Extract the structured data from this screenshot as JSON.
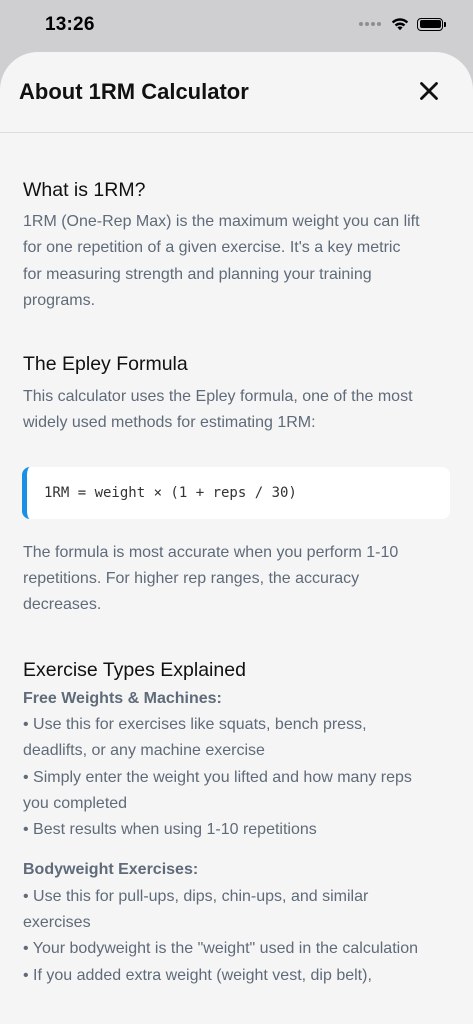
{
  "status_bar": {
    "time": "13:26"
  },
  "header": {
    "title": "About 1RM Calculator",
    "close_icon": "close-x-icon"
  },
  "sections": {
    "what": {
      "heading": "What is 1RM?",
      "lines": [
        "1RM (One-Rep Max) is the maximum weight you can lift",
        "for one repetition of a given exercise. It's a key metric",
        "for measuring strength and planning your training",
        "programs."
      ]
    },
    "epley": {
      "heading": "The Epley Formula",
      "intro_lines": [
        "This calculator uses the Epley formula, one of the most",
        "widely used methods for estimating 1RM:"
      ],
      "formula": "1RM = weight × (1 + reps / 30)",
      "note_lines": [
        "The formula is most accurate when you perform 1-10",
        "repetitions. For higher rep ranges, the accuracy",
        "decreases."
      ]
    },
    "types": {
      "heading": "Exercise Types Explained",
      "free_weights": {
        "title": "Free Weights & Machines:",
        "lines": [
          "• Use this for exercises like squats, bench press,",
          "deadlifts, or any machine exercise",
          "• Simply enter the weight you lifted and how many reps",
          "you completed",
          "• Best results when using 1-10 repetitions"
        ]
      },
      "bodyweight": {
        "title": "Bodyweight Exercises:",
        "lines": [
          "• Use this for pull-ups, dips, chin-ups, and similar",
          "exercises",
          "• Your bodyweight is the \"weight\" used in the calculation",
          "• If you added extra weight (weight vest, dip belt),"
        ]
      }
    }
  },
  "colors": {
    "accent": "#1a8fe3",
    "heading": "#111111",
    "body_text": "#5f6b7a",
    "sheet_bg": "#f5f5f5"
  }
}
